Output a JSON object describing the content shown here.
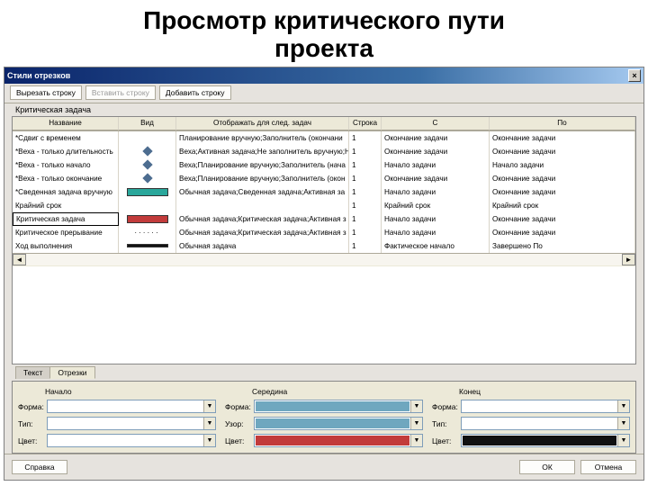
{
  "title_line1": "Просмотр критического пути",
  "title_line2": "проекта",
  "window_title": "Стили отрезков",
  "toolbar": {
    "cut": "Вырезать строку",
    "paste": "Вставить строку",
    "add": "Добавить строку"
  },
  "section_label": "Критическая задача",
  "headers": {
    "name": "Название",
    "vid": "Вид",
    "show": "Отображать для след. задач",
    "row": "Строка",
    "s": "С",
    "po": "По"
  },
  "rows": [
    {
      "name": "*Сдвиг с временем",
      "kind": "blank",
      "show": "Планирование вручную;Заполнитель (окончани",
      "row": "1",
      "s": "Окончание задачи",
      "po": "Окончание задачи"
    },
    {
      "name": "*Веха - только длительность",
      "kind": "diamond",
      "show": "Веха;Активная задача;Не заполнитель вручную;Н",
      "row": "1",
      "s": "Окончание задачи",
      "po": "Окончание задачи"
    },
    {
      "name": "*Веха - только начало",
      "kind": "diamond",
      "show": "Веха;Планирование вручную;Заполнитель (нача",
      "row": "1",
      "s": "Начало задачи",
      "po": "Начало задачи"
    },
    {
      "name": "*Веха - только окончание",
      "kind": "diamond",
      "show": "Веха;Планирование вручную;Заполнитель (окон",
      "row": "1",
      "s": "Окончание задачи",
      "po": "Окончание задачи"
    },
    {
      "name": "*Сведенная задача вручную",
      "kind": "teal",
      "show": "Обычная задача;Сведенная задача;Активная за",
      "row": "1",
      "s": "Начало задачи",
      "po": "Окончание задачи"
    },
    {
      "name": "Крайний срок",
      "kind": "blank",
      "show": "",
      "row": "1",
      "s": "Крайний срок",
      "po": "Крайний срок"
    },
    {
      "name": "Критическая задача",
      "kind": "red",
      "show": "Обычная задача;Критическая задача;Активная з",
      "row": "1",
      "s": "Начало задачи",
      "po": "Окончание задачи"
    },
    {
      "name": "Критическое прерывание",
      "kind": "dots",
      "show": "Обычная задача;Критическая задача;Активная з",
      "row": "1",
      "s": "Начало задачи",
      "po": "Окончание задачи"
    },
    {
      "name": "Ход выполнения",
      "kind": "black",
      "show": "Обычная задача",
      "row": "1",
      "s": "Фактическое начало",
      "po": "Завершено По"
    }
  ],
  "tabs": {
    "text": "Текст",
    "bars": "Отрезки"
  },
  "groups": {
    "start": {
      "label": "Начало",
      "forma": "Форма:",
      "tip": "Тип:",
      "cvet": "Цвет:"
    },
    "mid": {
      "label": "Середина",
      "forma": "Форма:",
      "uzor": "Узор:",
      "cvet": "Цвет:"
    },
    "end": {
      "label": "Конец",
      "forma": "Форма:",
      "tip": "Тип:",
      "cvet": "Цвет:"
    }
  },
  "colors": {
    "mid_forma": "#6fa7bf",
    "mid_uzor": "#6fa7bf",
    "mid_cvet": "#c23b3b",
    "end_cvet": "#111111"
  },
  "footer": {
    "help": "Справка",
    "ok": "ОК",
    "cancel": "Отмена"
  }
}
